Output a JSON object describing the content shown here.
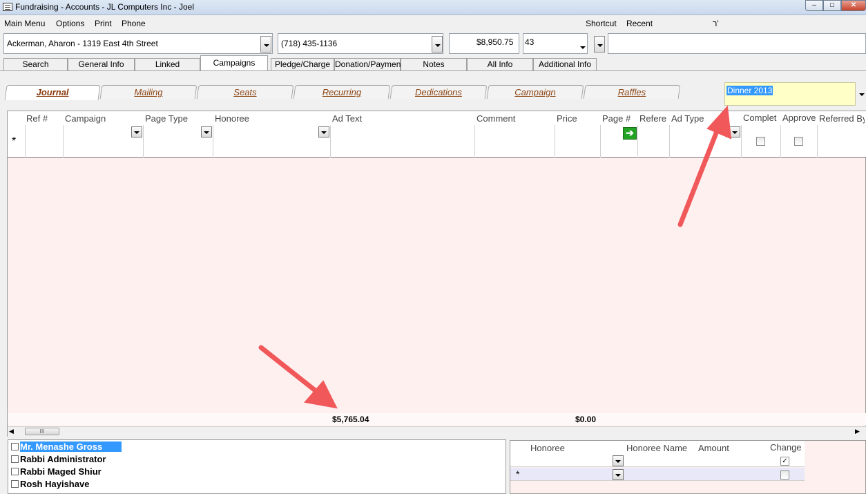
{
  "window": {
    "title": "Fundraising - Accounts - JL Computers Inc - Joel"
  },
  "menu": {
    "items": [
      "Main Menu",
      "Options",
      "Print",
      "Phone"
    ],
    "shortcut": "Shortcut",
    "recent": "Recent",
    "extra": "ר'"
  },
  "account": {
    "name": "Ackerman, Aharon - 1319 East 4th Street",
    "phone": "(718) 435-1136",
    "balance": "$8,950.75",
    "number": "43"
  },
  "main_tabs": [
    "Search",
    "General Info",
    "Linked",
    "Campaigns",
    "Pledge/Charge",
    "Donation/Payment",
    "Notes",
    "All Info",
    "Additional Info"
  ],
  "active_main_tab": "Campaigns",
  "sub_tabs": [
    "Journal",
    "Mailing",
    "Seats",
    "Recurring",
    "Dedications",
    "Campaign",
    "Raffles"
  ],
  "active_sub_tab": "Journal",
  "campaign_select": {
    "value": "Dinner 2013"
  },
  "grid": {
    "columns": [
      "Ref #",
      "Campaign",
      "Page Type",
      "Honoree",
      "Ad Text",
      "Comment",
      "Price",
      "Page #",
      "Refere",
      "Ad Type",
      "Complet",
      "Approve",
      "Referred By"
    ],
    "new_row_marker": "*",
    "total_ad_text": "$5,765.04",
    "total_price": "$0.00"
  },
  "scrollbar": {
    "thumb_glyph": "III"
  },
  "honoree_list": [
    {
      "label": "Mr. Menashe Gross",
      "selected": true
    },
    {
      "label": "Rabbi Administrator",
      "selected": false
    },
    {
      "label": "Rabbi Maged Shiur",
      "selected": false
    },
    {
      "label": "Rosh Hayishave",
      "selected": false
    }
  ],
  "subgrid": {
    "columns": [
      "Honoree",
      "Honoree Name",
      "Amount",
      "Change"
    ],
    "row1_change_checked": true,
    "row2_change_checked": false,
    "new_row_marker": "*"
  },
  "colors": {
    "grid_background": "#fff0f0",
    "selection": "#3399ff",
    "campaign_highlight": "#ffffc8",
    "tab_text": "#8b4513",
    "arrow": "#f0585a"
  }
}
